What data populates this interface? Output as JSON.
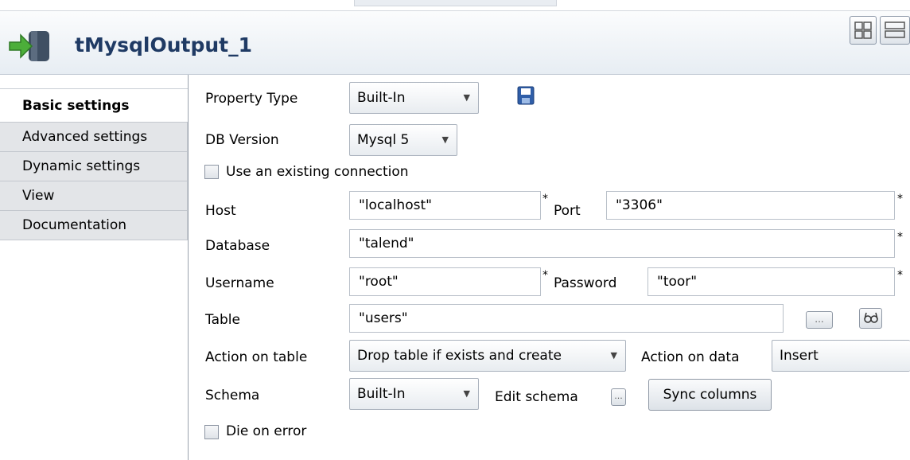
{
  "component": {
    "title": "tMysqlOutput_1",
    "icon": "database-output-icon"
  },
  "tabs": [
    {
      "label": "Basic settings",
      "active": true
    },
    {
      "label": "Advanced settings",
      "active": false
    },
    {
      "label": "Dynamic settings",
      "active": false
    },
    {
      "label": "View",
      "active": false
    },
    {
      "label": "Documentation",
      "active": false
    }
  ],
  "form": {
    "property_type": {
      "label": "Property Type",
      "value": "Built-In"
    },
    "db_version": {
      "label": "DB Version",
      "value": "Mysql 5"
    },
    "use_existing_connection": {
      "label": "Use an existing connection",
      "checked": false
    },
    "host": {
      "label": "Host",
      "value": "\"localhost\""
    },
    "port": {
      "label": "Port",
      "value": "\"3306\""
    },
    "database": {
      "label": "Database",
      "value": "\"talend\""
    },
    "username": {
      "label": "Username",
      "value": "\"root\""
    },
    "password": {
      "label": "Password",
      "value": "\"toor\""
    },
    "table": {
      "label": "Table",
      "value": "\"users\"",
      "browse_label": "..."
    },
    "action_on_table": {
      "label": "Action on table",
      "value": "Drop table if exists and create"
    },
    "action_on_data": {
      "label": "Action on data",
      "value": "Insert"
    },
    "schema": {
      "label": "Schema",
      "value": "Built-In",
      "edit_label": "Edit schema",
      "edit_button_label": "...",
      "sync_label": "Sync columns"
    },
    "die_on_error": {
      "label": "Die on error",
      "checked": false
    },
    "required_marker": "*"
  },
  "colors": {
    "title": "#1f3a64",
    "header_bg": "#e7edf3",
    "save_icon": "#2f5ea8"
  }
}
